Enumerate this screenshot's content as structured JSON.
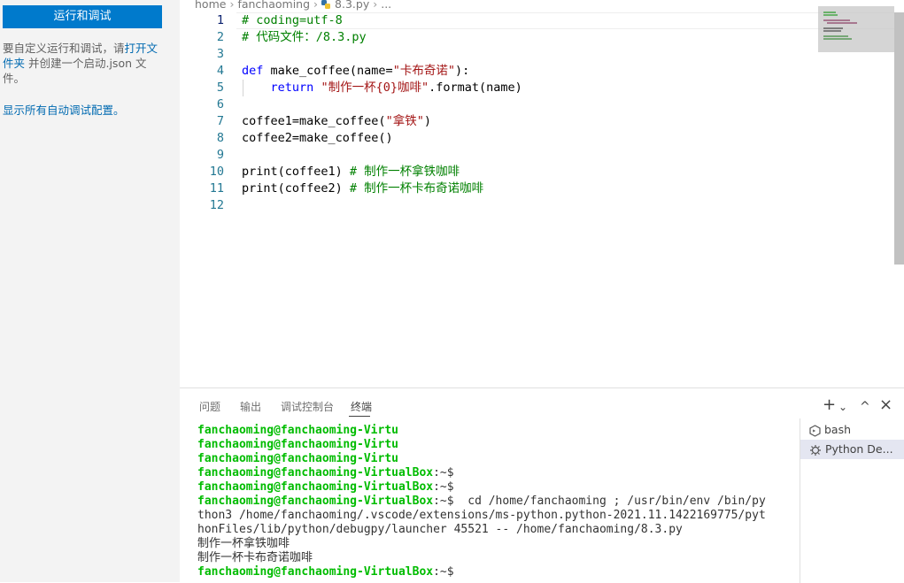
{
  "sidebar": {
    "run_button": "运行和调试",
    "desc_prefix": "要自定义运行和调试，请",
    "open_folder_link": "打开文件夹",
    "desc_suffix": " 并创建一个启动.json 文件。",
    "show_all_link": "显示所有自动调试配置。"
  },
  "breadcrumb": {
    "items": [
      "home",
      "fanchaoming",
      "8.3.py",
      "..."
    ],
    "file_icon": "python-file-icon"
  },
  "editor": {
    "line_numbers": [
      "1",
      "2",
      "3",
      "4",
      "5",
      "6",
      "7",
      "8",
      "9",
      "10",
      "11",
      "12"
    ],
    "active_line": "1",
    "lines": [
      {
        "segments": [
          {
            "t": "# coding=utf-8",
            "c": "com"
          }
        ]
      },
      {
        "segments": [
          {
            "t": "# 代码文件：/8.3.py",
            "c": "com"
          }
        ]
      },
      {
        "segments": []
      },
      {
        "segments": [
          {
            "t": "def",
            "c": "kw"
          },
          {
            "t": " make_coffee(name=",
            "c": "fn"
          },
          {
            "t": "\"卡布奇诺\"",
            "c": "str"
          },
          {
            "t": "):",
            "c": "fn"
          }
        ]
      },
      {
        "segments": [
          {
            "t": "    ",
            "c": "fn"
          },
          {
            "t": "return",
            "c": "kw"
          },
          {
            "t": " ",
            "c": "fn"
          },
          {
            "t": "\"制作一杯{0}咖啡\"",
            "c": "str"
          },
          {
            "t": ".format(name)",
            "c": "fn"
          }
        ]
      },
      {
        "segments": []
      },
      {
        "segments": [
          {
            "t": "coffee1=make_coffee(",
            "c": "fn"
          },
          {
            "t": "\"拿铁\"",
            "c": "str"
          },
          {
            "t": ")",
            "c": "fn"
          }
        ]
      },
      {
        "segments": [
          {
            "t": "coffee2=make_coffee()",
            "c": "fn"
          }
        ]
      },
      {
        "segments": []
      },
      {
        "segments": [
          {
            "t": "print(coffee1) ",
            "c": "fn"
          },
          {
            "t": "# 制作一杯拿铁咖啡",
            "c": "com"
          }
        ]
      },
      {
        "segments": [
          {
            "t": "print(coffee2) ",
            "c": "fn"
          },
          {
            "t": "# 制作一杯卡布奇诺咖啡",
            "c": "com"
          }
        ]
      },
      {
        "segments": []
      }
    ]
  },
  "panel": {
    "tabs": [
      "问题",
      "输出",
      "调试控制台",
      "终端"
    ],
    "active_tab": "终端",
    "actions": {
      "new_terminal": "+",
      "dropdown": "⌄",
      "maximize": "^",
      "close": "×"
    },
    "terminal_lines": [
      {
        "prompt": "fanchaoming@fanchaoming-Virtu",
        "rest": ""
      },
      {
        "prompt": "fanchaoming@fanchaoming-Virtu",
        "rest": ""
      },
      {
        "prompt": "fanchaoming@fanchaoming-Virtu",
        "rest": ""
      },
      {
        "prompt": "fanchaoming@fanchaoming-VirtualBox",
        "rest": ":~$"
      },
      {
        "prompt": "fanchaoming@fanchaoming-VirtualBox",
        "rest": ":~$"
      },
      {
        "prompt": "fanchaoming@fanchaoming-VirtualBox",
        "rest": ":~$  cd /home/fanchaoming ; /usr/bin/env /bin/py"
      },
      {
        "prompt": "",
        "rest": "thon3 /home/fanchaoming/.vscode/extensions/ms-python.python-2021.11.1422169775/pyt"
      },
      {
        "prompt": "",
        "rest": "honFiles/lib/python/debugpy/launcher 45521 -- /home/fanchaoming/8.3.py"
      },
      {
        "prompt": "",
        "rest": "制作一杯拿铁咖啡"
      },
      {
        "prompt": "",
        "rest": "制作一杯卡布奇诺咖啡"
      },
      {
        "prompt": "fanchaoming@fanchaoming-VirtualBox",
        "rest": ":~$"
      }
    ],
    "terminals": [
      {
        "label": "bash",
        "icon": "terminal-icon"
      },
      {
        "label": "Python De...",
        "icon": "debug-icon"
      }
    ]
  },
  "colors": {
    "accent": "#007acc",
    "prompt": "#00bc00",
    "comment": "#008000",
    "keyword": "#0000ff",
    "string": "#a31515"
  }
}
